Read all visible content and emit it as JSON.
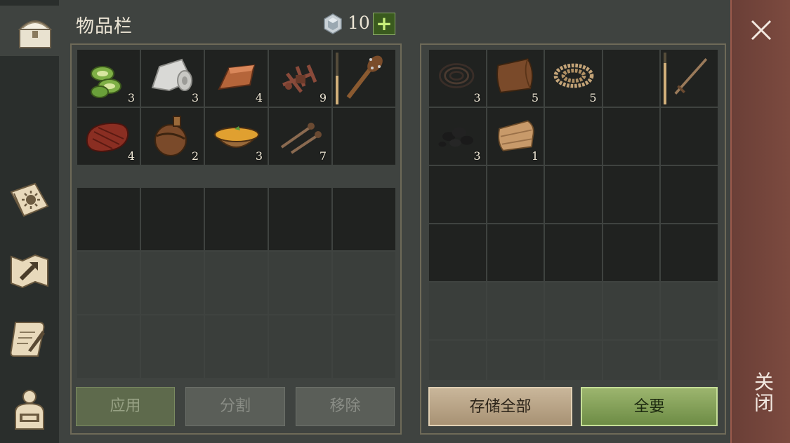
{
  "title": "物品栏",
  "currency": {
    "amount": "10",
    "add_symbol": "+",
    "icon": "gem-icon"
  },
  "nav": [
    {
      "icon": "chest-icon",
      "active": true
    },
    {
      "icon": "sun-book-icon"
    },
    {
      "icon": "craft-map-icon"
    },
    {
      "icon": "quest-scroll-icon"
    },
    {
      "icon": "character-backpack-icon"
    }
  ],
  "inventory": {
    "slots": [
      {
        "icon": "sliced-cactus-icon",
        "qty": "3"
      },
      {
        "icon": "cloth-roll-icon",
        "qty": "3"
      },
      {
        "icon": "copper-ingot-icon",
        "qty": "4"
      },
      {
        "icon": "scrap-parts-icon",
        "qty": "9"
      },
      {
        "icon": "spiked-club-icon",
        "durability": 0.55
      },
      {
        "icon": "steak-icon",
        "qty": "4"
      },
      {
        "icon": "water-flask-icon",
        "qty": "2"
      },
      {
        "icon": "soup-bowl-icon",
        "qty": "3"
      },
      {
        "icon": "nails-icon",
        "qty": "7"
      },
      {
        "icon": ""
      }
    ]
  },
  "storage": {
    "slots": [
      {
        "icon": "wire-icon",
        "qty": "3"
      },
      {
        "icon": "leather-icon",
        "qty": "5"
      },
      {
        "icon": "rope-icon",
        "qty": "5"
      },
      {
        "icon": ""
      },
      {
        "icon": "sword-icon",
        "durability": 0.8
      },
      {
        "icon": "coal-icon",
        "qty": "3"
      },
      {
        "icon": "folded-fabric-icon",
        "qty": "1"
      }
    ]
  },
  "buttons": {
    "apply": "应用",
    "split": "分割",
    "remove": "移除",
    "store_all": "存储全部",
    "take_all": "全要"
  },
  "close": {
    "label": "关闭",
    "icon": "close-icon"
  },
  "colors": {
    "accent_green": "#7f9f4f",
    "close_bar": "#74463c",
    "slot_bg": "#202220"
  }
}
